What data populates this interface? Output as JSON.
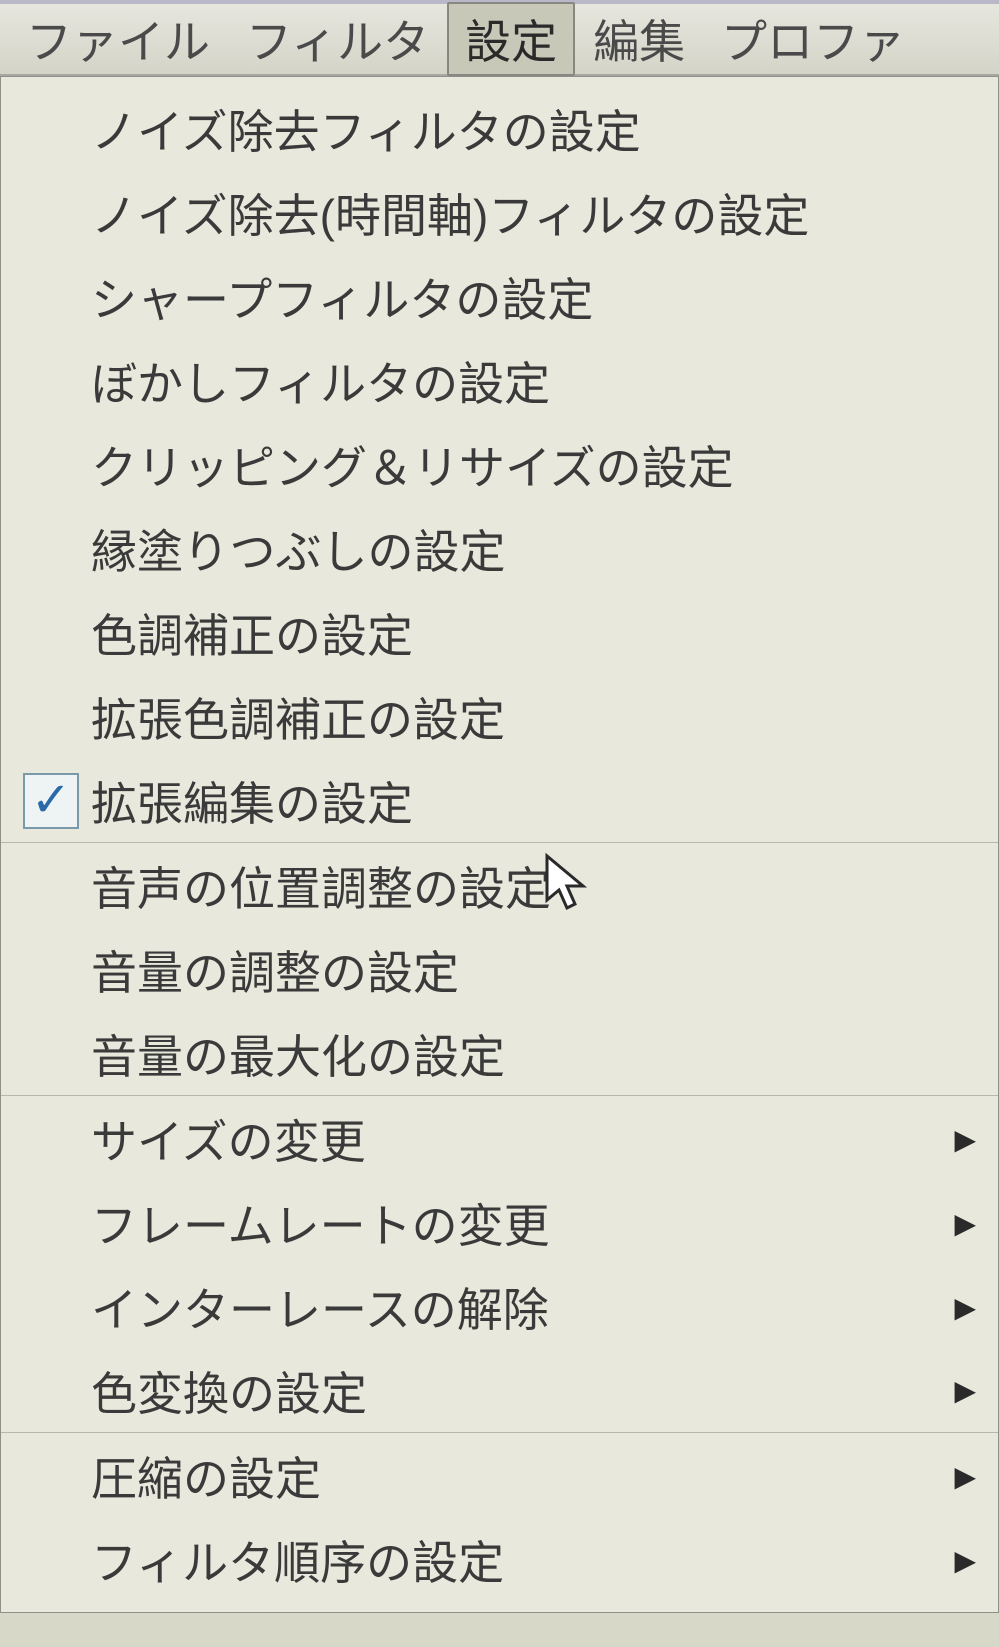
{
  "menubar": {
    "items": [
      {
        "label": "ファイル",
        "active": false
      },
      {
        "label": "フィルタ",
        "active": false
      },
      {
        "label": "設定",
        "active": true
      },
      {
        "label": "編集",
        "active": false
      },
      {
        "label": "プロファ",
        "active": false
      }
    ]
  },
  "dropdown": {
    "items": [
      {
        "label": "ノイズ除去フィルタの設定",
        "checked": false,
        "submenu": false,
        "sep_after": false
      },
      {
        "label": "ノイズ除去(時間軸)フィルタの設定",
        "checked": false,
        "submenu": false,
        "sep_after": false
      },
      {
        "label": "シャープフィルタの設定",
        "checked": false,
        "submenu": false,
        "sep_after": false
      },
      {
        "label": "ぼかしフィルタの設定",
        "checked": false,
        "submenu": false,
        "sep_after": false
      },
      {
        "label": "クリッピング＆リサイズの設定",
        "checked": false,
        "submenu": false,
        "sep_after": false
      },
      {
        "label": "縁塗りつぶしの設定",
        "checked": false,
        "submenu": false,
        "sep_after": false
      },
      {
        "label": "色調補正の設定",
        "checked": false,
        "submenu": false,
        "sep_after": false
      },
      {
        "label": "拡張色調補正の設定",
        "checked": false,
        "submenu": false,
        "sep_after": false
      },
      {
        "label": "拡張編集の設定",
        "checked": true,
        "submenu": false,
        "sep_after": true
      },
      {
        "label": "音声の位置調整の設定",
        "checked": false,
        "submenu": false,
        "sep_after": false
      },
      {
        "label": "音量の調整の設定",
        "checked": false,
        "submenu": false,
        "sep_after": false
      },
      {
        "label": "音量の最大化の設定",
        "checked": false,
        "submenu": false,
        "sep_after": true
      },
      {
        "label": "サイズの変更",
        "checked": false,
        "submenu": true,
        "sep_after": false
      },
      {
        "label": "フレームレートの変更",
        "checked": false,
        "submenu": true,
        "sep_after": false
      },
      {
        "label": "インターレースの解除",
        "checked": false,
        "submenu": true,
        "sep_after": false
      },
      {
        "label": "色変換の設定",
        "checked": false,
        "submenu": true,
        "sep_after": true
      },
      {
        "label": "圧縮の設定",
        "checked": false,
        "submenu": true,
        "sep_after": false
      },
      {
        "label": "フィルタ順序の設定",
        "checked": false,
        "submenu": true,
        "sep_after": false
      }
    ]
  },
  "ui": {
    "check_glyph": "✓",
    "arrow_glyph": "▶"
  }
}
